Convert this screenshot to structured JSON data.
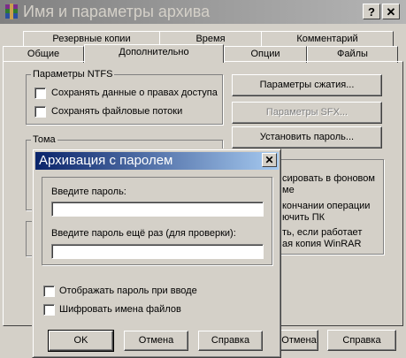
{
  "window": {
    "title": "Имя и параметры архива",
    "help_btn": "?",
    "close_btn": "✕"
  },
  "tabs_row1": [
    {
      "label": "Резервные копии"
    },
    {
      "label": "Время"
    },
    {
      "label": "Комментарий"
    }
  ],
  "tabs_row2": [
    {
      "label": "Общие"
    },
    {
      "label": "Дополнительно"
    },
    {
      "label": "Опции"
    },
    {
      "label": "Файлы"
    }
  ],
  "ntfs": {
    "title": "Параметры NTFS",
    "save_security": "Сохранять данные о правах доступа",
    "save_streams": "Сохранять файловые потоки"
  },
  "volumes": {
    "title": "Тома"
  },
  "right_buttons": {
    "compression": "Параметры сжатия...",
    "sfx": "Параметры SFX...",
    "password": "Установить пароль..."
  },
  "background_text": {
    "line1": "сировать в фоновом",
    "line2": "ме",
    "line3": "кончании операции",
    "line4": "ючить ПК",
    "line5": "ть, если работает",
    "line6": "ая копия WinRAR"
  },
  "main_buttons": {
    "cancel": "Отмена",
    "help": "Справка"
  },
  "dialog": {
    "title": "Архивация с паролем",
    "close_btn": "✕",
    "password_label": "Введите пароль:",
    "password_value": "",
    "confirm_label": "Введите пароль ещё раз (для проверки):",
    "confirm_value": "",
    "show_password": "Отображать пароль при вводе",
    "encrypt_names": "Шифровать имена файлов",
    "ok": "OK",
    "cancel": "Отмена",
    "help": "Справка"
  }
}
